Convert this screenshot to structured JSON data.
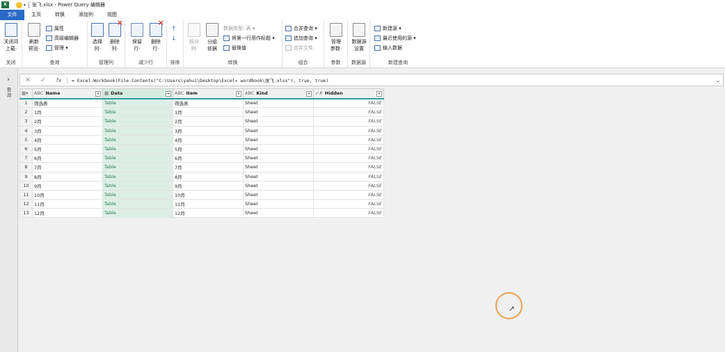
{
  "titlebar": {
    "app_icon": "X",
    "title": "张飞.xlsx - Power Query 编辑器"
  },
  "tabs": [
    "文件",
    "主页",
    "转换",
    "添加列",
    "视图"
  ],
  "ribbon": {
    "groups": [
      "关闭",
      "查询",
      "管理列",
      "减少行",
      "排序",
      "转换",
      "组合",
      "参数",
      "数据源",
      "新建查询"
    ],
    "close_apply": [
      "关闭并",
      "上载·"
    ],
    "refresh": [
      "刷新",
      "预览·"
    ],
    "properties": "属性",
    "advanced_editor": "高级编辑器",
    "manage": "管理 ▾",
    "choose_columns": [
      "选择",
      "列·"
    ],
    "remove_columns": [
      "删除",
      "列·"
    ],
    "keep_rows": [
      "保留",
      "行·"
    ],
    "remove_rows": [
      "删除",
      "行·"
    ],
    "split_column": [
      "拆分",
      "列·"
    ],
    "group_by": [
      "分组",
      "依据"
    ],
    "data_type": "数据类型: 表 ▾",
    "use_first_row": "将第一行用作标题 ▾",
    "replace_values": "替换值",
    "merge_queries": "合并查询 ▾",
    "append_queries": "追加查询 ▾",
    "combine_files": "合并文件",
    "manage_params": [
      "管理",
      "参数·"
    ],
    "datasource_settings": [
      "数据源",
      "设置"
    ],
    "new_source": "新建源 ▾",
    "recent_sources": "最近使用的源 ▾",
    "enter_data": "输入数据"
  },
  "left_panel": {
    "expand": "›",
    "label": "查询"
  },
  "formula_bar": {
    "cancel": "✕",
    "confirm": "✓",
    "fx": "fx",
    "formula": "= Excel.Workbook(File.Contents(\"C:\\Users\\yahui\\Desktop\\Excel« wordbook\\张飞.xlsx\"), true, true)"
  },
  "table": {
    "columns": [
      {
        "name": "Name",
        "type": "ABC"
      },
      {
        "name": "Data",
        "type": "▦"
      },
      {
        "name": "Item",
        "type": "ABC"
      },
      {
        "name": "Kind",
        "type": "ABC"
      },
      {
        "name": "Hidden",
        "type": "✓✗"
      }
    ],
    "rows": [
      [
        "1",
        "筛选表",
        "Table",
        "筛选表",
        "Sheet",
        "FALSE"
      ],
      [
        "2",
        "1月",
        "Table",
        "1月",
        "Sheet",
        "FALSE"
      ],
      [
        "3",
        "2月",
        "Table",
        "2月",
        "Sheet",
        "FALSE"
      ],
      [
        "4",
        "3月",
        "Table",
        "3月",
        "Sheet",
        "FALSE"
      ],
      [
        "5",
        "4月",
        "Table",
        "4月",
        "Sheet",
        "FALSE"
      ],
      [
        "6",
        "5月",
        "Table",
        "5月",
        "Sheet",
        "FALSE"
      ],
      [
        "7",
        "6月",
        "Table",
        "6月",
        "Sheet",
        "FALSE"
      ],
      [
        "8",
        "7月",
        "Table",
        "7月",
        "Sheet",
        "FALSE"
      ],
      [
        "9",
        "8月",
        "Table",
        "8月",
        "Sheet",
        "FALSE"
      ],
      [
        "10",
        "9月",
        "Table",
        "9月",
        "Sheet",
        "FALSE"
      ],
      [
        "11",
        "10月",
        "Table",
        "10月",
        "Sheet",
        "FALSE"
      ],
      [
        "12",
        "11月",
        "Table",
        "11月",
        "Sheet",
        "FALSE"
      ],
      [
        "13",
        "12月",
        "Table",
        "12月",
        "Sheet",
        "FALSE"
      ]
    ]
  },
  "colors": {
    "accent": "#2a6ac8",
    "data_column": "#dcefe6",
    "header_underline": "#2b9e9e",
    "cursor_ring": "#e9a24f"
  }
}
